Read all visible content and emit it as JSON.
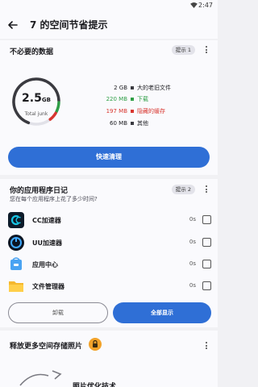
{
  "status_bar": {
    "time": "2:47",
    "wifi_icon": "wifi-icon"
  },
  "app_bar": {
    "back_icon": "back-arrow-icon",
    "title": "7 的空间节省提示"
  },
  "junk_card": {
    "title": "不必要的数据",
    "tip_label": "提示 1",
    "gauge_number": "2.5",
    "gauge_unit": "GB",
    "gauge_caption": "Total junk",
    "gauge_segments": [
      {
        "name": "大的老旧文件",
        "fraction": 0.7,
        "color": "#3a3a40"
      },
      {
        "name": "下载",
        "fraction": 0.08,
        "color": "#2e9e46"
      },
      {
        "name": "隐藏的缓存",
        "fraction": 0.07,
        "color": "#d8362f"
      }
    ],
    "legend": [
      {
        "size": "2 GB",
        "label": "大的老旧文件",
        "color": "#3a3a40",
        "text_color": "#1b1b1f"
      },
      {
        "size": "220 MB",
        "label": "下载",
        "color": "#2e9e46",
        "text_color": "#2e9e46"
      },
      {
        "size": "197 MB",
        "label": "隐藏的缓存",
        "color": "#d8362f",
        "text_color": "#d8362f"
      },
      {
        "size": "60 MB",
        "label": "其他",
        "color": "#3a3a40",
        "text_color": "#1b1b1f"
      }
    ],
    "button": "快速清理"
  },
  "diary_card": {
    "title": "你的应用程序日记",
    "tip_label": "提示 2",
    "subtitle": "您在每个应用程序上花了多少时间?",
    "apps": [
      {
        "name": "CC加速器",
        "time": "0s",
        "icon": "cc-accelerator-icon"
      },
      {
        "name": "UU加速器",
        "time": "0s",
        "icon": "uu-accelerator-icon"
      },
      {
        "name": "应用中心",
        "time": "0s",
        "icon": "app-center-icon"
      },
      {
        "name": "文件管理器",
        "time": "0s",
        "icon": "file-manager-icon"
      }
    ],
    "uninstall_button": "卸载",
    "show_all_button": "全部显示"
  },
  "photo_card": {
    "title": "释放更多空间存储照片",
    "lock_icon": "lock-icon",
    "peek_title": "照片优化技术"
  },
  "colors": {
    "accent": "#2f6fd6",
    "card_bg": "#fafafd",
    "page_bg": "#f1f1f4"
  }
}
